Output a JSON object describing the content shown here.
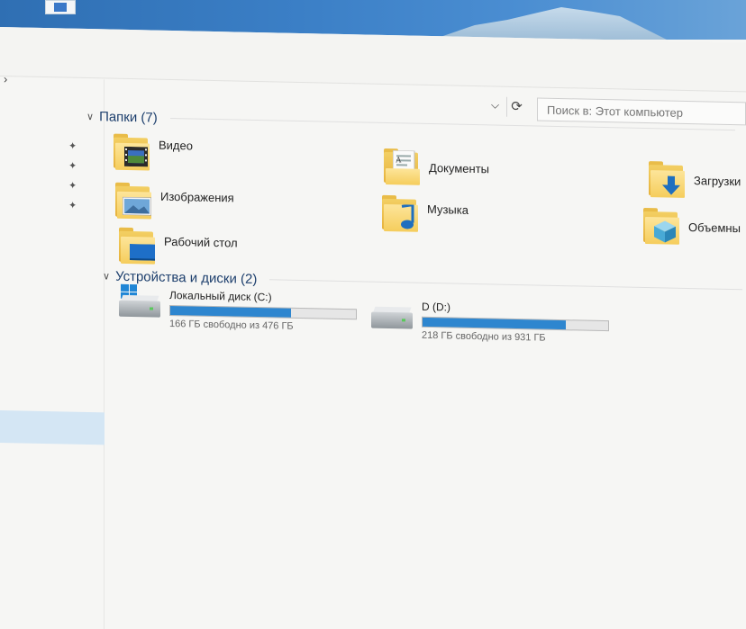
{
  "search": {
    "placeholder": "Поиск в: Этот компьютер"
  },
  "folders_group": {
    "title": "Папки (7)",
    "items": [
      {
        "label": "Видео",
        "icon": "video-folder-icon"
      },
      {
        "label": "Документы",
        "icon": "documents-folder-icon"
      },
      {
        "label": "Загрузки",
        "icon": "downloads-folder-icon"
      },
      {
        "label": "Изображения",
        "icon": "pictures-folder-icon"
      },
      {
        "label": "Музыка",
        "icon": "music-folder-icon"
      },
      {
        "label": "Объемны",
        "icon": "3d-objects-folder-icon"
      },
      {
        "label": "Рабочий стол",
        "icon": "desktop-folder-icon"
      }
    ]
  },
  "drives_group": {
    "title": "Устройства и диски (2)",
    "drives": [
      {
        "name": "Локальный диск (C:)",
        "free_text": "166 ГБ свободно из 476 ГБ",
        "used_fraction": 0.65
      },
      {
        "name": "D (D:)",
        "free_text": "218 ГБ свободно из 931 ГБ",
        "used_fraction": 0.77
      }
    ]
  },
  "colors": {
    "accent": "#2e86cf",
    "header": "#1d3f6d",
    "folder": "#f5cd5c"
  }
}
